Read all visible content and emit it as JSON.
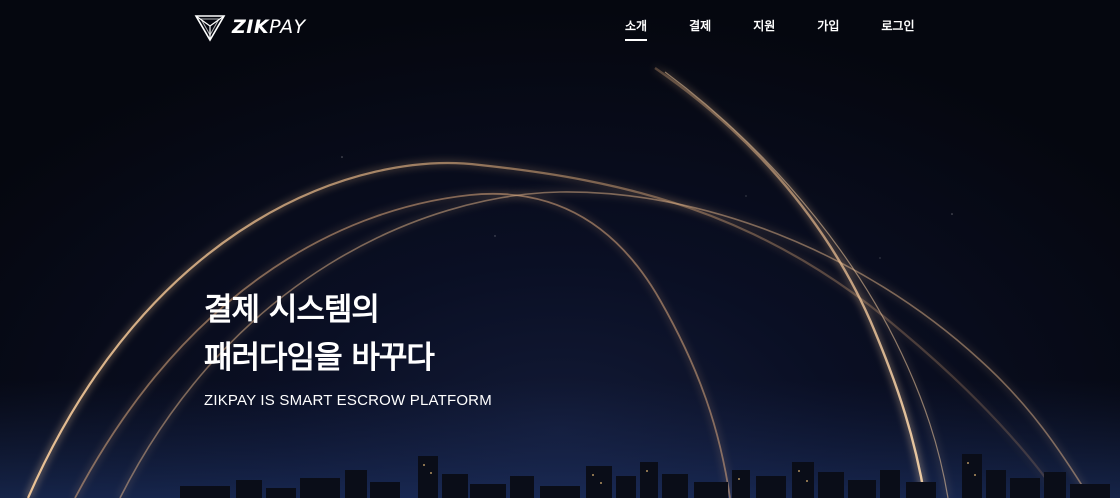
{
  "brand": {
    "logo_icon": "triangle-logo-icon",
    "name_bold": "ZIK",
    "name_light": "PAY"
  },
  "nav": {
    "items": [
      {
        "label": "소개",
        "active": true
      },
      {
        "label": "결제",
        "active": false
      },
      {
        "label": "지원",
        "active": false
      },
      {
        "label": "가입",
        "active": false
      },
      {
        "label": "로그인",
        "active": false
      }
    ]
  },
  "hero": {
    "headline_line1": "결제 시스템의",
    "headline_line2": "패러다임을 바꾸다",
    "subtitle": "ZIKPAY IS SMART ESCROW PLATFORM",
    "background": "night-city-skyline-with-light-arcs"
  },
  "colors": {
    "background": "#060912",
    "arc_glow": "#e8b98a",
    "text": "#ffffff"
  }
}
